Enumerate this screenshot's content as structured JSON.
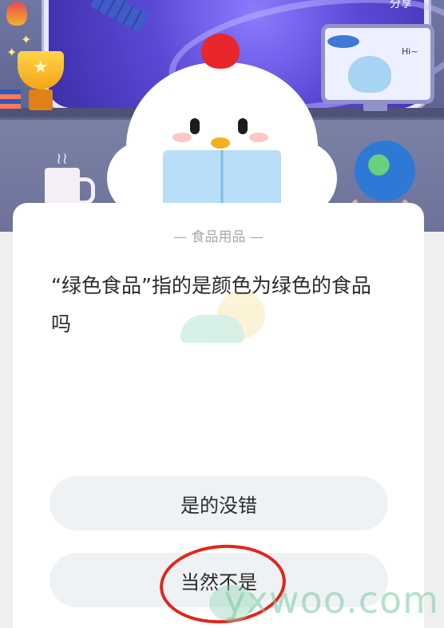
{
  "header": {
    "top_right_text": "分享",
    "monitor_greeting": "Hi~"
  },
  "quiz": {
    "category": "— 食品用品 —",
    "question": "“绿色食品”指的是颜色为绿色的食品吗",
    "options": [
      {
        "label": "是的没错"
      },
      {
        "label": "当然不是"
      }
    ],
    "highlighted_option_index": 1
  },
  "watermark": {
    "site_text": "yxwoo.com"
  },
  "colors": {
    "accent_red": "#e0261c",
    "option_bg": "#eff2f5",
    "card_bg": "#ffffff"
  }
}
